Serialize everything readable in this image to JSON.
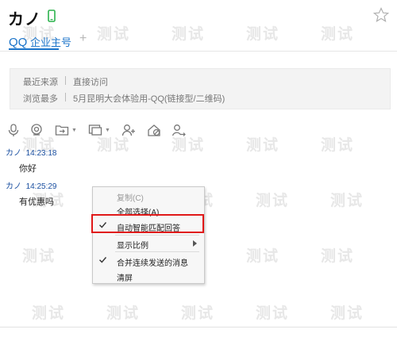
{
  "header": {
    "title": "カノ",
    "status_icon": "phone-icon",
    "favorite_icon": "star-icon"
  },
  "tabs": [
    {
      "label_prefix": "QQ",
      "label_suffix": "企业主号",
      "active": true
    }
  ],
  "tab_add_label": "+",
  "info": {
    "recent_source_label": "最近来源",
    "recent_source_value": "直接访问",
    "most_viewed_label": "浏览最多",
    "most_viewed_value": "5月昆明大会体验用-QQ(链接型/二维码)"
  },
  "toolbar": {
    "icons": [
      "microphone-icon",
      "camera-icon",
      "folder-transfer-icon",
      "screen-share-icon",
      "add-user-icon",
      "block-user-icon",
      "transfer-user-icon"
    ]
  },
  "messages": [
    {
      "sender": "カノ",
      "time": "14:23:18",
      "text": "你好"
    },
    {
      "sender": "カノ",
      "time": "14:25:29",
      "text": "有优惠吗"
    }
  ],
  "context_menu": {
    "items": [
      {
        "label": "复制(C)",
        "checked": false,
        "disabled": true,
        "submenu": false
      },
      {
        "label": "全部选择(A)",
        "checked": false,
        "disabled": false,
        "submenu": false
      },
      {
        "label": "自动智能匹配回答",
        "checked": true,
        "disabled": false,
        "submenu": false,
        "highlighted": true
      },
      {
        "label": "显示比例",
        "checked": false,
        "disabled": false,
        "submenu": true
      },
      {
        "label": "合并连续发送的消息",
        "checked": true,
        "disabled": false,
        "submenu": false
      },
      {
        "label": "清屏",
        "checked": false,
        "disabled": false,
        "submenu": false
      }
    ]
  },
  "watermark": "测试",
  "colors": {
    "accent": "#1a73c9",
    "highlight_border": "#e01818",
    "status_green": "#2bb24c"
  }
}
